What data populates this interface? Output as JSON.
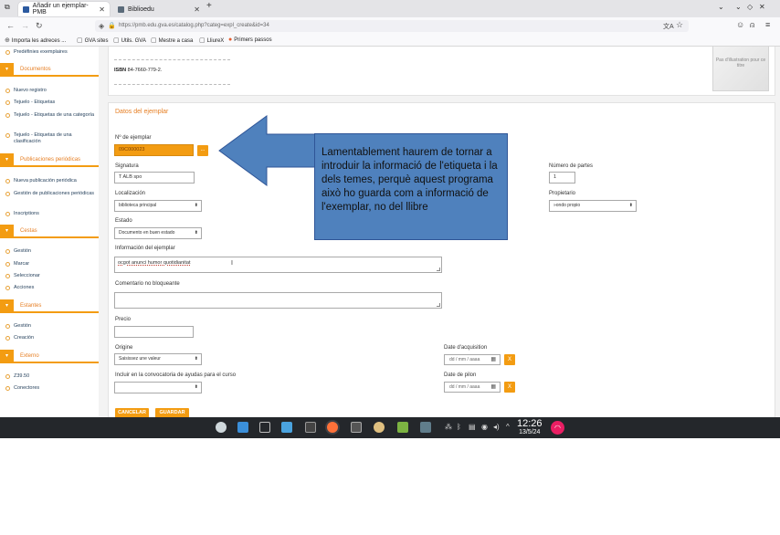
{
  "browser": {
    "tabs": [
      {
        "label": "Añadir un ejemplar-PMB",
        "active": true
      },
      {
        "label": "Biblioedu",
        "active": false
      }
    ],
    "new_tab": "+",
    "url": "https://pmb.edu.gva.es/catalog.php?categ=expl_create&id=34",
    "bookmarks": [
      "Importa les adreces ...",
      "GVA sites",
      "Utils. GVA",
      "Mestre a casa",
      "LliureX",
      "Primers passos"
    ]
  },
  "sidebar": {
    "top_items": [
      "Predéfinies exemplaires"
    ],
    "sections": [
      {
        "title": "Documentos",
        "items": [
          "Nuevo registro",
          "Tejuelo - Etiquetas",
          "Tejuelo - Etiquetas de una categoría",
          "Tejuelo - Etiquetas de una clasificación"
        ]
      },
      {
        "title": "Publicaciones periódicas",
        "items": [
          "Nueva publicación periódica",
          "Gestión de publicaciones periódicas",
          "Inscriptions"
        ]
      },
      {
        "title": "Cestas",
        "items": [
          "Gestión",
          "Marcar",
          "Seleccionar",
          "Acciones"
        ]
      },
      {
        "title": "Estantes",
        "items": [
          "Gestión",
          "Creación"
        ]
      },
      {
        "title": "Externo",
        "items": [
          "Z39.50",
          "Conectores"
        ]
      }
    ]
  },
  "record": {
    "isbn_label": "ISBN",
    "isbn_value": "84-7660-779-2.",
    "cover_text": "Pas d'illustration pour ce titre"
  },
  "form": {
    "section_title": "Datos del ejemplar",
    "barcode_label": "Nº de ejemplar",
    "barcode_value": "09C000023",
    "barcode_button": "...",
    "signatura_label": "Signatura",
    "signatura_value": "T ALB spo",
    "localizacion_label": "Localización",
    "localizacion_value": "biblioteca principal",
    "estado_label": "Estado",
    "estado_value": "Documento en buen estado",
    "informacion_label": "Información del ejemplar",
    "informacion_value": "ocgot anunci humor quotidianitat",
    "comentario_label": "Comentario no bloqueante",
    "comentario_value": "",
    "precio_label": "Precio",
    "precio_value": "",
    "origine_label": "Origine",
    "origine_value": "Saisissez une valeur",
    "ayudas_label": "Incluir en la convocatoria de ayudas para el curso",
    "ayudas_value": "",
    "partes_label": "Número de partes",
    "partes_value": "1",
    "propietario_label": "Propietario",
    "propietario_value": "»ondo propio",
    "adquisicion_label": "Date d'acquisition",
    "adquisicion_placeholder": "dd / mm / aaaa",
    "pilon_label": "Date de pilon",
    "pilon_placeholder": "dd / mm / aaaa",
    "clear_label": "X",
    "cancel_label": "CANCELAR",
    "save_label": "GUARDAR"
  },
  "annotation": {
    "text": "Lamentablement haurem de tornar a introduir la informació de l'etiqueta i la dels temes, perquè aquest programa això ho guarda com a informació de l'exemplar, no del llibre",
    "color": "#4f81bd"
  },
  "taskbar": {
    "time": "12:26",
    "date": "13/5/24"
  }
}
